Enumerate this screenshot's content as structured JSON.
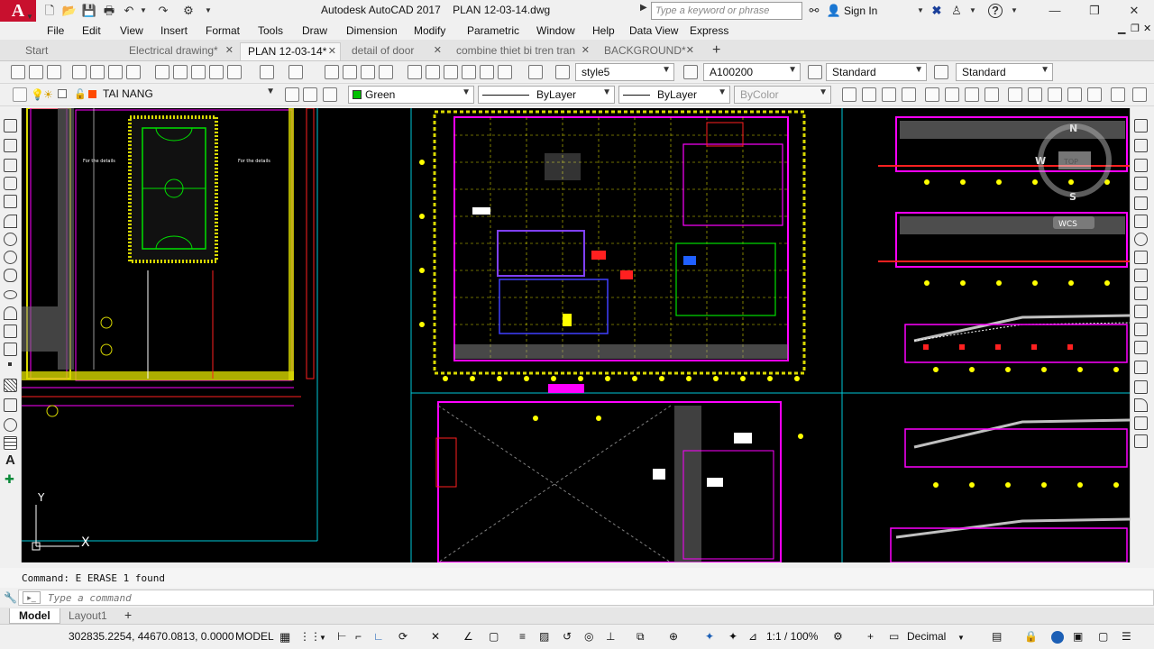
{
  "app": {
    "logo": "A",
    "title": "Autodesk AutoCAD 2017",
    "filename": "PLAN 12-03-14.dwg",
    "search_placeholder": "Type a keyword or phrase",
    "sign_in": "Sign In",
    "help_icon": "?"
  },
  "menu": [
    "File",
    "Edit",
    "View",
    "Insert",
    "Format",
    "Tools",
    "Draw",
    "Dimension",
    "Modify",
    "Parametric",
    "Window",
    "Help",
    "Data View",
    "Express"
  ],
  "tabs": [
    {
      "label": "Start",
      "active": false,
      "closable": false
    },
    {
      "label": "Electrical drawing*",
      "active": false,
      "closable": true
    },
    {
      "label": "PLAN 12-03-14*",
      "active": true,
      "closable": true
    },
    {
      "label": "detail of door",
      "active": false,
      "closable": true
    },
    {
      "label": "combine thiet bi tren tran",
      "active": false,
      "closable": true
    },
    {
      "label": "BACKGROUND*",
      "active": false,
      "closable": true
    }
  ],
  "tab_add": "+",
  "toolbar1": {
    "text_style": "style5",
    "dim_style": "A100200",
    "table_style": "Standard",
    "multileader_style": "Standard"
  },
  "toolbar2": {
    "layer": "TAI NANG",
    "color": "Green",
    "linetype": "ByLayer",
    "lineweight": "ByLayer",
    "plotstyle": "ByColor"
  },
  "viewcube": {
    "north": "N",
    "west": "W",
    "south": "S",
    "top": "TOP",
    "ucs": "WCS"
  },
  "axes": {
    "x": "X",
    "y": "Y"
  },
  "command": {
    "history": "Command: E ERASE 1 found",
    "placeholder": "Type a command"
  },
  "layout_tabs": [
    {
      "label": "Model",
      "active": true
    },
    {
      "label": "Layout1",
      "active": false
    }
  ],
  "layout_add": "+",
  "status": {
    "coords": "302835.2254, 44670.0813, 0.0000",
    "space": "MODEL",
    "annoscale": "1:1 / 100%",
    "units": "Decimal"
  },
  "colors": {
    "drawing_bg": "#000000",
    "autocad_red": "#c8102e",
    "layer_green": "#00c000"
  }
}
